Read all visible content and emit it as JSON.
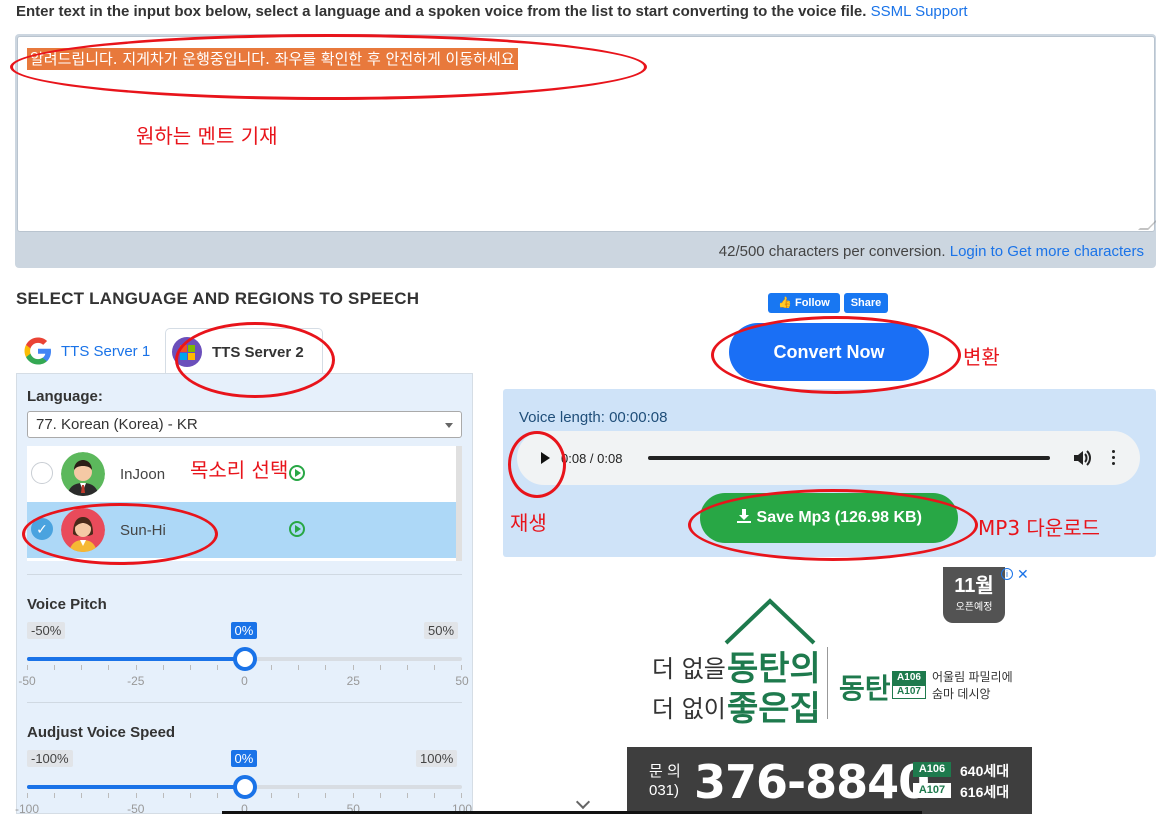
{
  "instructions": {
    "text": "Enter text in the input box below, select a language and a spoken voice from the list to start converting to the voice file.",
    "ssml_link": "SSML Support"
  },
  "editor": {
    "input_text": "알려드립니다. 지게차가 운행중입니다.  좌우를 확인한 후 안전하게 이동하세요",
    "char_count": "42/500 characters per conversion.",
    "login_link": "Login to Get more characters"
  },
  "section_heading": "SELECT LANGUAGE AND REGIONS TO SPEECH",
  "social": {
    "follow": "Follow",
    "share": "Share"
  },
  "tabs": [
    {
      "label": "TTS Server 1",
      "icon": "google-icon",
      "active": false
    },
    {
      "label": "TTS Server 2",
      "icon": "microsoft-icon",
      "active": true
    }
  ],
  "language": {
    "label": "Language:",
    "selected": "77. Korean (Korea) - KR"
  },
  "voices": [
    {
      "name": "InJoon",
      "selected": false,
      "icon": "avatar-male-icon"
    },
    {
      "name": "Sun-Hi",
      "selected": true,
      "icon": "avatar-female-icon"
    }
  ],
  "pitch": {
    "title": "Voice Pitch",
    "min_label": "-50%",
    "max_label": "50%",
    "current_label": "0%",
    "value": 0,
    "min": -50,
    "max": 50,
    "scale": [
      "-50",
      "-25",
      "0",
      "25",
      "50"
    ]
  },
  "speed": {
    "title": "Audjust Voice Speed",
    "min_label": "-100%",
    "max_label": "100%",
    "current_label": "0%",
    "value": 0,
    "min": -100,
    "max": 100,
    "scale": [
      "-100",
      "-50",
      "0",
      "50",
      "100"
    ]
  },
  "convert_label": "Convert Now",
  "player": {
    "voice_length": "Voice length: 00:00:08",
    "time": "0:08 / 0:08",
    "progress": 1.0
  },
  "save_label": "Save Mp3 (126.98 KB)",
  "ad": {
    "badge_month": "11월",
    "badge_sub": "오픈예정",
    "info": "i",
    "close": "✕",
    "line1": "더 없을",
    "line2": "더 없이",
    "big1": "동탄의",
    "big2": "좋은집",
    "brand": "동탄",
    "code1": "A106",
    "code2": "A107",
    "desc1": "어울림 파밀리에",
    "desc2": "숨마   데시앙",
    "inquiry": "문 의 031)",
    "phone": "376-8840",
    "unit1": "A106",
    "count1": "640세대",
    "unit2": "A107",
    "count2": "616세대"
  },
  "annotations": {
    "memo_text": "원하는 멘트 기재",
    "convert": "변환",
    "voice_select": "목소리 선택",
    "play": "재생",
    "download": "MP3 다운로드",
    "color": "#e8141b"
  },
  "colors": {
    "accent_blue": "#1a73e8",
    "convert_blue": "#1a6ff5",
    "save_green": "#28a745",
    "text_highlight": "#e8793c",
    "selected_row": "#add8f7"
  }
}
